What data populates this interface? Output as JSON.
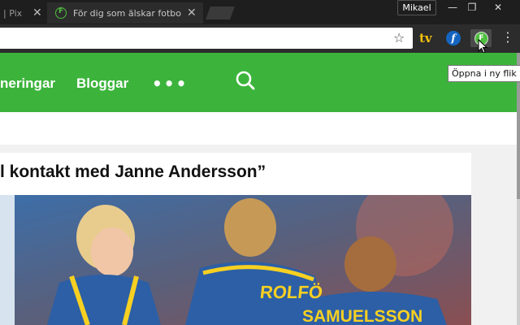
{
  "tabs": {
    "prev_title": "| Pix",
    "active_title": "För dig som älskar fotboll",
    "close_glyph": "✕"
  },
  "window": {
    "profile": "Mikael",
    "minimize": "—",
    "restore": "❐",
    "close": "✕"
  },
  "toolbar": {
    "url": "",
    "star": "☆",
    "ext_tv": "tv",
    "ext_f": "f",
    "ext_fotboll": "F",
    "menu": "⋮",
    "tooltip": "Öppna i ny flik"
  },
  "site": {
    "nav": [
      "neringar",
      "Bloggar"
    ],
    "more": "•••",
    "accent": "#3cb43c"
  },
  "article": {
    "headline": "l kontakt med Janne Andersson”",
    "jersey_left": "ROLFÖ",
    "jersey_right": "SAMUELSSON"
  }
}
